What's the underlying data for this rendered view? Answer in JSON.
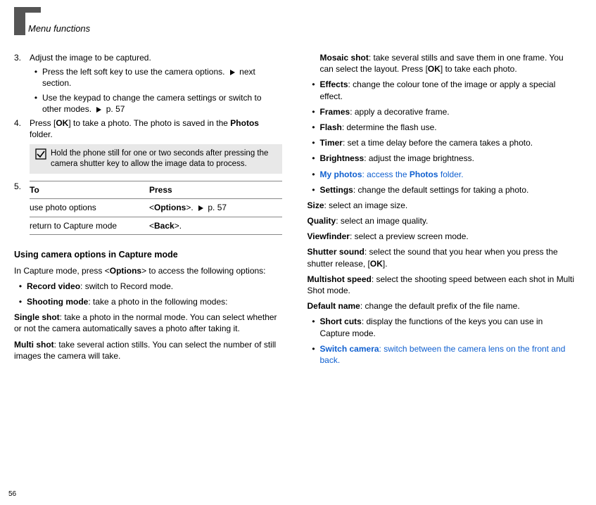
{
  "header": {
    "running_title": "Menu functions"
  },
  "pagenum": "56",
  "col1": {
    "step3": {
      "num": "3.",
      "text": "Adjust the image to be captured.",
      "sub1a": "Press the left soft key to use the camera options.",
      "sub1b": "next section.",
      "sub2a": "Use the keypad to change the camera settings or switch to other modes.",
      "sub2b": "p. 57"
    },
    "step4": {
      "num": "4.",
      "a": "Press [",
      "b": "OK",
      "c": "] to take a photo. The photo is saved in the ",
      "d": "Photos",
      "e": " folder."
    },
    "note": "Hold the phone still for one or two seconds after pressing the camera shutter key to allow the image data to process.",
    "step5": {
      "num": "5."
    },
    "table": {
      "h1": "To",
      "h2": "Press",
      "r1c1": "use photo options",
      "r1c2a": "<",
      "r1c2b": "Options",
      "r1c2c": ">.",
      "r1c2d": "p. 57",
      "r2c1": "return to Capture mode",
      "r2c2a": "<",
      "r2c2b": "Back",
      "r2c2c": ">."
    },
    "subhead": "Using camera options in Capture mode",
    "intro_a": "In Capture mode, press <",
    "intro_b": "Options",
    "intro_c": "> to access the following options:",
    "opt_record": {
      "label": "Record video",
      "desc": ": switch to Record mode."
    },
    "opt_shooting": {
      "label": "Shooting mode",
      "desc": ": take a photo in the following modes:"
    },
    "single": {
      "label": "Single shot",
      "desc": ": take a photo in the normal mode. You can select whether or not the camera automatically saves a photo after taking it."
    },
    "multi": {
      "label": "Multi shot",
      "desc": ": take several action stills. You can select the number of still images the camera will take."
    }
  },
  "col2": {
    "mosaic": {
      "label": "Mosaic shot",
      "a": ": take several stills and save them in one frame. You can select the layout. Press [",
      "b": "OK",
      "c": "] to take each photo."
    },
    "effects": {
      "label": "Effects",
      "desc": ": change the colour tone of the image or apply a special effect."
    },
    "frames": {
      "label": "Frames",
      "desc": ": apply a decorative frame."
    },
    "flash": {
      "label": "Flash",
      "desc": ": determine the flash use."
    },
    "timer": {
      "label": "Timer",
      "desc": ": set a time delay before the camera takes a photo."
    },
    "brightness": {
      "label": "Brightness",
      "desc": ": adjust the image brightness."
    },
    "myphotos": {
      "label": "My photos",
      "a": ": access the ",
      "b": "Photos",
      "c": " folder."
    },
    "settings": {
      "label": "Settings",
      "desc": ": change the default settings for taking a photo."
    },
    "size": {
      "label": "Size",
      "desc": ": select an image size."
    },
    "quality": {
      "label": "Quality",
      "desc": ": select an image quality."
    },
    "viewfinder": {
      "label": "Viewfinder",
      "desc": ": select a preview screen mode."
    },
    "shuttersound": {
      "label": "Shutter sound",
      "a": ": select the sound that you hear when you press the shutter release, [",
      "b": "OK",
      "c": "]."
    },
    "multispeed": {
      "label": "Multishot speed",
      "desc": ": select the shooting speed between each shot in Multi Shot mode."
    },
    "defaultname": {
      "label": "Default name",
      "desc": ": change the default prefix of the file name."
    },
    "shortcuts": {
      "label": "Short cuts",
      "desc": ": display the functions of the keys you can use in Capture mode."
    },
    "switchcam": {
      "label": "Switch camera",
      "desc": ": switch between the camera lens on the front and back."
    }
  }
}
